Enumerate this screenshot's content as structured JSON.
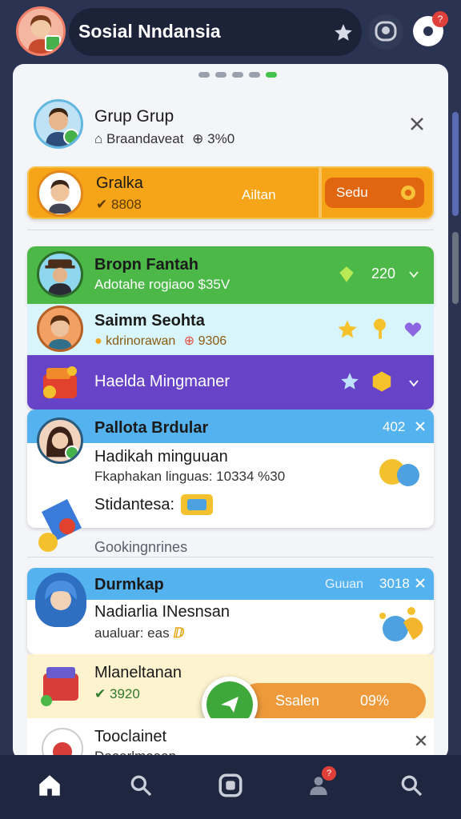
{
  "header": {
    "title": "Sosial Nndansia",
    "notification_badge": "?"
  },
  "group_header": {
    "title": "Grup Grup",
    "subtitle": "Braandaveat",
    "subtitle_value": "3%0"
  },
  "orange_card": {
    "name": "Gralka",
    "value": "8808",
    "action_label": "Ailtan",
    "button_label": "Sedu"
  },
  "green_row": {
    "name": "Bropn Fantah",
    "subtitle": "Adotahe rogiaoo $35V",
    "value": "220"
  },
  "cyan_row": {
    "name": "Saimm Seohta",
    "subtitle": "kdrinorawan",
    "value": "9306"
  },
  "purple_row": {
    "name": "Haelda Mingmaner"
  },
  "card_one": {
    "header": "Pallota Brdular",
    "header_value": "402",
    "line1": "Hadikah minguuan",
    "line2": "Fkaphakan linguas: 10334 %30",
    "line3": "Stidantesa:"
  },
  "section_label": "Gookingnrines",
  "card_two": {
    "header": "Durmkap",
    "header_right": "Guuan",
    "header_value": "3018",
    "line1": "Nadiarlia INesnsan",
    "line2": "aualuar: eas"
  },
  "yellow_row": {
    "name": "Mlaneltanan",
    "value": "3920",
    "progress_label": "Ssalen",
    "progress_value": "09%"
  },
  "last_row": {
    "name": "Tooclainet",
    "subtitle": "Deoarlmoaan"
  },
  "bottom_nav": {
    "badge": "?"
  },
  "colors": {
    "green": "#4cb848",
    "orange": "#f6a418",
    "purple": "#6743c8",
    "cyan": "#d8f5fb",
    "blue": "#54b2ee"
  }
}
